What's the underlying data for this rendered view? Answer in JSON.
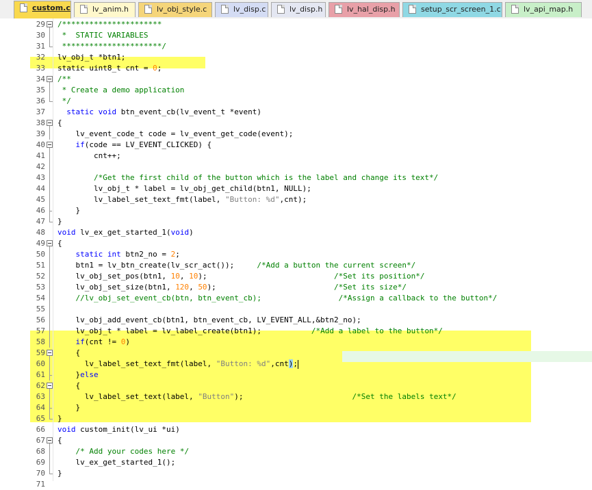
{
  "tabs": [
    {
      "label": "custom.c",
      "color": "#f9d94e",
      "active": true
    },
    {
      "label": "lv_anim.h",
      "color": "#fff8cc",
      "active": false
    },
    {
      "label": "lv_obj_style.c",
      "color": "#f5d57a",
      "active": false
    },
    {
      "label": "lv_disp.c",
      "color": "#d4dcf4",
      "active": false
    },
    {
      "label": "lv_disp.h",
      "color": "#e4e7f2",
      "active": false
    },
    {
      "label": "lv_hal_disp.h",
      "color": "#e8a0a8",
      "active": false
    },
    {
      "label": "setup_scr_screen_1.c",
      "color": "#8fd8e4",
      "active": false
    },
    {
      "label": "lv_api_map.h",
      "color": "#c8efc8",
      "active": false
    }
  ],
  "colors": {
    "highlight": "#ffff66",
    "current_line": "#e6f8e6",
    "comment": "#008000",
    "keyword": "#0000ff",
    "string": "#808080",
    "number": "#ff8000"
  },
  "lines": [
    {
      "num": "29",
      "fold": "box",
      "tokens": [
        {
          "t": "/**********************",
          "c": "cm"
        }
      ]
    },
    {
      "num": "30",
      "fold": "line",
      "tokens": [
        {
          "t": " *  STATIC VARIABLES",
          "c": "cm"
        }
      ]
    },
    {
      "num": "31",
      "fold": "end",
      "tokens": [
        {
          "t": " **********************/",
          "c": "cm"
        }
      ]
    },
    {
      "num": "32",
      "fold": "",
      "tokens": [
        {
          "t": "lv_obj_t *btn1;",
          "c": ""
        }
      ]
    },
    {
      "num": "33",
      "fold": "",
      "tokens": [
        {
          "t": "static uint8_t cnt = ",
          "c": ""
        },
        {
          "t": "0",
          "c": "nm"
        },
        {
          "t": ";",
          "c": ""
        }
      ]
    },
    {
      "num": "34",
      "fold": "box",
      "tokens": [
        {
          "t": "/**",
          "c": "cm"
        }
      ]
    },
    {
      "num": "35",
      "fold": "line",
      "tokens": [
        {
          "t": " * Create a demo application",
          "c": "cm"
        }
      ]
    },
    {
      "num": "36",
      "fold": "end",
      "tokens": [
        {
          "t": " */",
          "c": "cm"
        }
      ]
    },
    {
      "num": "37",
      "fold": "",
      "tokens": [
        {
          "t": "  ",
          "c": ""
        },
        {
          "t": "static void",
          "c": "kw"
        },
        {
          "t": " btn_event_cb(lv_event_t *event)",
          "c": ""
        }
      ]
    },
    {
      "num": "38",
      "fold": "box",
      "tokens": [
        {
          "t": "{",
          "c": ""
        }
      ]
    },
    {
      "num": "39",
      "fold": "line",
      "tokens": [
        {
          "t": "    lv_event_code_t code = lv_event_get_code(event);",
          "c": ""
        }
      ]
    },
    {
      "num": "40",
      "fold": "box",
      "tokens": [
        {
          "t": "    ",
          "c": ""
        },
        {
          "t": "if",
          "c": "kw"
        },
        {
          "t": "(code == LV_EVENT_CLICKED) {",
          "c": ""
        }
      ]
    },
    {
      "num": "41",
      "fold": "line",
      "tokens": [
        {
          "t": "        cnt++;",
          "c": ""
        }
      ]
    },
    {
      "num": "42",
      "fold": "line",
      "tokens": []
    },
    {
      "num": "43",
      "fold": "line",
      "tokens": [
        {
          "t": "        ",
          "c": ""
        },
        {
          "t": "/*Get the first child of the button which is the label and change its text*/",
          "c": "cm"
        }
      ]
    },
    {
      "num": "44",
      "fold": "line",
      "tokens": [
        {
          "t": "        lv_obj_t * label = lv_obj_get_child(btn1, NULL);",
          "c": ""
        }
      ]
    },
    {
      "num": "45",
      "fold": "line",
      "tokens": [
        {
          "t": "        lv_label_set_text_fmt(label, ",
          "c": ""
        },
        {
          "t": "\"Button: %d\"",
          "c": "st"
        },
        {
          "t": ",cnt);",
          "c": ""
        }
      ]
    },
    {
      "num": "46",
      "fold": "tick",
      "tokens": [
        {
          "t": "    }",
          "c": ""
        }
      ]
    },
    {
      "num": "47",
      "fold": "end",
      "tokens": [
        {
          "t": "}",
          "c": ""
        }
      ]
    },
    {
      "num": "48",
      "fold": "",
      "tokens": [
        {
          "t": "void",
          "c": "kw"
        },
        {
          "t": " lv_ex_get_started_1(",
          "c": ""
        },
        {
          "t": "void",
          "c": "kw"
        },
        {
          "t": ")",
          "c": ""
        }
      ]
    },
    {
      "num": "49",
      "fold": "box",
      "tokens": [
        {
          "t": "{",
          "c": ""
        }
      ]
    },
    {
      "num": "50",
      "fold": "line",
      "tokens": [
        {
          "t": "    ",
          "c": ""
        },
        {
          "t": "static int",
          "c": "kw"
        },
        {
          "t": " btn2_no = ",
          "c": ""
        },
        {
          "t": "2",
          "c": "nm"
        },
        {
          "t": ";",
          "c": ""
        }
      ]
    },
    {
      "num": "51",
      "fold": "line",
      "tokens": [
        {
          "t": "    btn1 = lv_btn_create(lv_scr_act());     ",
          "c": ""
        },
        {
          "t": "/*Add a button the current screen*/",
          "c": "cm"
        }
      ]
    },
    {
      "num": "52",
      "fold": "line",
      "tokens": [
        {
          "t": "    lv_obj_set_pos(btn1, ",
          "c": ""
        },
        {
          "t": "10",
          "c": "nm"
        },
        {
          "t": ", ",
          "c": ""
        },
        {
          "t": "10",
          "c": "nm"
        },
        {
          "t": ");                            ",
          "c": ""
        },
        {
          "t": "/*Set its position*/",
          "c": "cm"
        }
      ]
    },
    {
      "num": "53",
      "fold": "line",
      "tokens": [
        {
          "t": "    lv_obj_set_size(btn1, ",
          "c": ""
        },
        {
          "t": "120",
          "c": "nm"
        },
        {
          "t": ", ",
          "c": ""
        },
        {
          "t": "50",
          "c": "nm"
        },
        {
          "t": ");                          ",
          "c": ""
        },
        {
          "t": "/*Set its size*/",
          "c": "cm"
        }
      ]
    },
    {
      "num": "54",
      "fold": "line",
      "tokens": [
        {
          "t": "    ",
          "c": ""
        },
        {
          "t": "//lv_obj_set_event_cb(btn, btn_event_cb);",
          "c": "cm"
        },
        {
          "t": "                 ",
          "c": ""
        },
        {
          "t": "/*Assign a callback to the button*/",
          "c": "cm"
        }
      ]
    },
    {
      "num": "55",
      "fold": "line",
      "tokens": []
    },
    {
      "num": "56",
      "fold": "line",
      "tokens": [
        {
          "t": "    lv_obj_add_event_cb(btn1, btn_event_cb, LV_EVENT_ALL,&btn2_no);",
          "c": ""
        }
      ]
    },
    {
      "num": "57",
      "fold": "line",
      "tokens": [
        {
          "t": "    lv_obj_t * label = lv_label_create(btn1);           ",
          "c": ""
        },
        {
          "t": "/*Add a label to the button*/",
          "c": "cm"
        }
      ]
    },
    {
      "num": "58",
      "fold": "line",
      "tokens": [
        {
          "t": "    ",
          "c": ""
        },
        {
          "t": "if",
          "c": "kw"
        },
        {
          "t": "(cnt != ",
          "c": ""
        },
        {
          "t": "0",
          "c": "nm"
        },
        {
          "t": ")",
          "c": ""
        }
      ]
    },
    {
      "num": "59",
      "fold": "box",
      "tokens": [
        {
          "t": "    {",
          "c": ""
        }
      ]
    },
    {
      "num": "60",
      "fold": "line",
      "tokens": [
        {
          "t": "      lv_label_set_text_fmt(label, ",
          "c": ""
        },
        {
          "t": "\"Button: %d\"",
          "c": "st"
        },
        {
          "t": ",cnt",
          "c": ""
        },
        {
          "t": ")",
          "c": "brm"
        },
        {
          "t": ";",
          "c": ""
        },
        {
          "t": "",
          "c": "caret"
        }
      ]
    },
    {
      "num": "61",
      "fold": "tick",
      "tokens": [
        {
          "t": "    }",
          "c": ""
        },
        {
          "t": "else",
          "c": "kw"
        }
      ]
    },
    {
      "num": "62",
      "fold": "box",
      "tokens": [
        {
          "t": "    {",
          "c": ""
        }
      ]
    },
    {
      "num": "63",
      "fold": "line",
      "tokens": [
        {
          "t": "      lv_label_set_text(label, ",
          "c": ""
        },
        {
          "t": "\"Button\"",
          "c": "st"
        },
        {
          "t": ");                        ",
          "c": ""
        },
        {
          "t": "/*Set the labels text*/",
          "c": "cm"
        }
      ]
    },
    {
      "num": "64",
      "fold": "tick",
      "tokens": [
        {
          "t": "    }",
          "c": ""
        }
      ]
    },
    {
      "num": "65",
      "fold": "end",
      "tokens": [
        {
          "t": "}",
          "c": ""
        }
      ]
    },
    {
      "num": "66",
      "fold": "",
      "tokens": [
        {
          "t": "void",
          "c": "kw"
        },
        {
          "t": " custom_init(lv_ui *ui)",
          "c": ""
        }
      ]
    },
    {
      "num": "67",
      "fold": "box",
      "tokens": [
        {
          "t": "{",
          "c": ""
        }
      ]
    },
    {
      "num": "68",
      "fold": "line",
      "tokens": [
        {
          "t": "    ",
          "c": ""
        },
        {
          "t": "/* Add your codes here */",
          "c": "cm"
        }
      ]
    },
    {
      "num": "69",
      "fold": "line",
      "tokens": [
        {
          "t": "    lv_ex_get_started_1();",
          "c": ""
        }
      ]
    },
    {
      "num": "70",
      "fold": "end",
      "tokens": [
        {
          "t": "}",
          "c": ""
        }
      ]
    },
    {
      "num": "71",
      "fold": "",
      "tokens": []
    }
  ]
}
